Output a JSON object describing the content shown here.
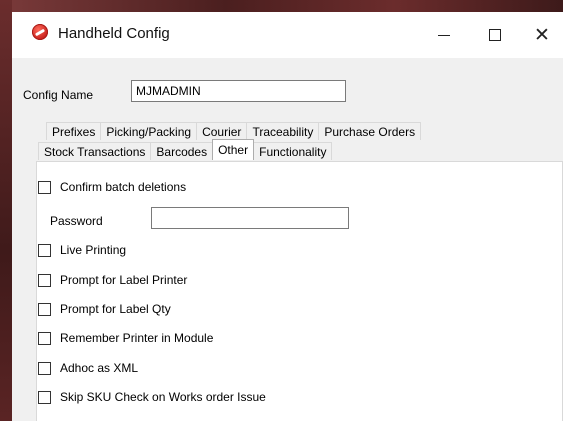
{
  "window": {
    "title": "Handheld Config",
    "minimize_icon": "minimize-icon",
    "maximize_icon": "maximize-icon",
    "close_icon": "close-icon",
    "close_glyph": "✕"
  },
  "config": {
    "label": "Config Name",
    "value": "MJMADMIN"
  },
  "tabs": {
    "row1": [
      "Prefixes",
      "Picking/Packing",
      "Courier",
      "Traceability",
      "Purchase Orders"
    ],
    "row2": [
      "Stock Transactions",
      "Barcodes",
      "Other",
      "Functionality"
    ],
    "active": "Other"
  },
  "options": {
    "confirm_batch_deletions": {
      "label": "Confirm batch deletions",
      "checked": false
    },
    "password": {
      "label": "Password",
      "value": ""
    },
    "live_printing": {
      "label": "Live Printing",
      "checked": false
    },
    "prompt_label_printer": {
      "label": "Prompt for Label Printer",
      "checked": false
    },
    "prompt_label_qty": {
      "label": "Prompt for Label Qty",
      "checked": false
    },
    "remember_printer": {
      "label": "Remember Printer in Module",
      "checked": false
    },
    "adhoc_xml": {
      "label": "Adhoc as XML",
      "checked": false
    },
    "skip_sku_check": {
      "label": "Skip SKU Check on Works order Issue",
      "checked": false
    }
  }
}
